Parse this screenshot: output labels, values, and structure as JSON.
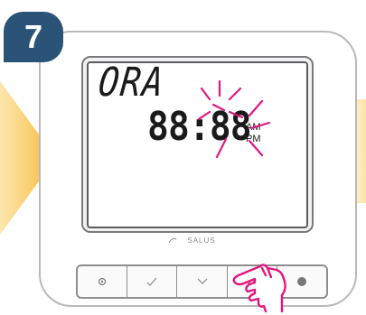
{
  "step": {
    "number": "7",
    "badge_color": "#2a5377"
  },
  "display": {
    "label": "ORA",
    "time": "88:88",
    "am": "AM",
    "pm": "PM"
  },
  "brand": {
    "name": "SALUS"
  },
  "buttons": [
    {
      "name": "settings",
      "icon": "gear-icon"
    },
    {
      "name": "confirm",
      "icon": "check-icon"
    },
    {
      "name": "down",
      "icon": "chevron-down-icon"
    },
    {
      "name": "up",
      "icon": "chevron-up-icon",
      "pressed": true
    },
    {
      "name": "power",
      "icon": "power-icon"
    }
  ],
  "colors": {
    "flash": "#e2157f",
    "arrow": "#f7c24a",
    "frame": "#b9b9bb"
  }
}
